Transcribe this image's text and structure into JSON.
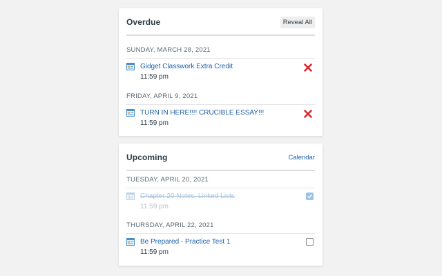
{
  "overdue": {
    "title": "Overdue",
    "reveal_all_label": "Reveal All",
    "groups": [
      {
        "date": "SUNDAY, MARCH 28, 2021",
        "items": [
          {
            "title": "Gidget Classwork Extra Credit",
            "time": "11:59 pm",
            "icon": "assignment-icon",
            "action": "dismiss-x-icon"
          }
        ]
      },
      {
        "date": "FRIDAY, APRIL 9, 2021",
        "items": [
          {
            "title": "TURN IN HERE!!!! CRUCIBLE ESSAY!!!",
            "time": "11:59 pm",
            "icon": "assignment-icon",
            "action": "dismiss-x-icon"
          }
        ]
      }
    ]
  },
  "upcoming": {
    "title": "Upcoming",
    "calendar_label": "Calendar",
    "groups": [
      {
        "date": "TUESDAY, APRIL 20, 2021",
        "items": [
          {
            "title": "Chapter 20 Notes, Linked Lists",
            "time": "11:59 pm",
            "icon": "assignment-icon",
            "completed": true
          }
        ]
      },
      {
        "date": "THURSDAY, APRIL 22, 2021",
        "items": [
          {
            "title": "Be Prepared - Practice Test 1",
            "time": "11:59 pm",
            "icon": "assignment-icon",
            "completed": false
          }
        ]
      }
    ]
  },
  "colors": {
    "link": "#1c5fa5",
    "dismiss": "#d7262b",
    "heading_text": "#2d3b45"
  }
}
